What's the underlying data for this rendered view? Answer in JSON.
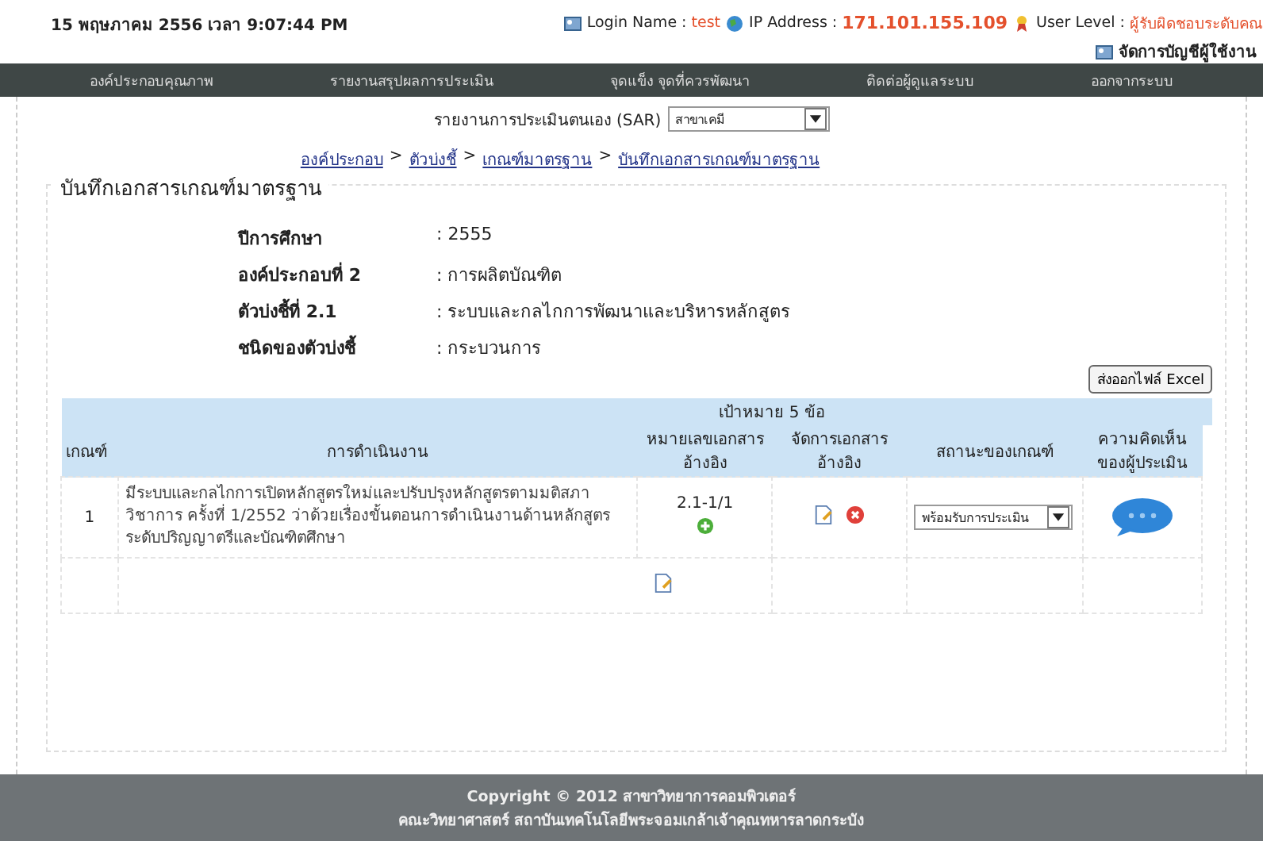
{
  "top_bar": {
    "datetime": "15 พฤษภาคม 2556 เวลา 9:07:44 PM",
    "login_label": "Login Name :",
    "login_value": "test",
    "ip_label": "IP Address :",
    "ip_value": "171.101.155.109",
    "level_label": "User Level :",
    "level_value": "ผู้รับผิดชอบระดับคณ",
    "account_link": "จัดการบัญชีผู้ใช้งาน"
  },
  "nav": [
    "องค์ประกอบคุณภาพ",
    "รายงานสรุปผลการประเมิน",
    "จุดแข็ง จุดที่ควรพัฒนา",
    "ติดต่อผู้ดูแลระบบ",
    "ออกจากระบบ"
  ],
  "sar": {
    "label": "รายงานการประเมินตนเอง (SAR)",
    "value": "สาขาเคมี"
  },
  "breadcrumb": [
    "องค์ประกอบ",
    "ตัวบ่งชี้",
    "เกณฑ์มาตรฐาน",
    "บันทึกเอกสารเกณฑ์มาตรฐาน"
  ],
  "breadcrumb_separator": ">",
  "section_title": "บันทึกเอกสารเกณฑ์มาตรฐาน",
  "info": [
    {
      "label": "ปีการศึกษา",
      "value": ": 2555"
    },
    {
      "label": "องค์ประกอบที่ 2",
      "value": ": การผลิตบัณฑิต"
    },
    {
      "label": "ตัวบ่งชี้ที่ 2.1",
      "value": ": ระบบและกลไกการพัฒนาและบริหารหลักสูตร"
    },
    {
      "label": "ชนิดของตัวบ่งชี้",
      "value": ": กระบวนการ"
    }
  ],
  "export_button": "ส่งออกไฟล์ Excel",
  "table": {
    "goal": "เป้าหมาย 5 ข้อ",
    "columns": [
      "เกณฑ์",
      "การดำเนินงาน",
      "หมายเลขเอกสารอ้างอิง",
      "จัดการเอกสารอ้างอิง",
      "สถานะของเกณฑ์",
      "ความคิดเห็นของผู้ประเมิน"
    ],
    "rows": [
      {
        "number": "1",
        "action": "มีระบบและกลไกการเปิดหลักสูตรใหม่และปรับปรุงหลักสูตรตามมติสภาวิชาการ ครั้งที่ 1/2552 ว่าด้วยเรื่องขั้นตอนการดำเนินงานด้านหลักสูตรระดับปริญญาตรีและบัณฑิตศึกษา",
        "document": "2.1-1/1",
        "status": "พร้อมรับการประเมิน"
      }
    ]
  },
  "footer": [
    "Copyright © 2012 สาขาวิทยาการคอมพิวเตอร์",
    "คณะวิทยาศาสตร์ สถาบันเทคโนโลยีพระจอมเกล้าเจ้าคุณทหารลาดกระบัง"
  ]
}
